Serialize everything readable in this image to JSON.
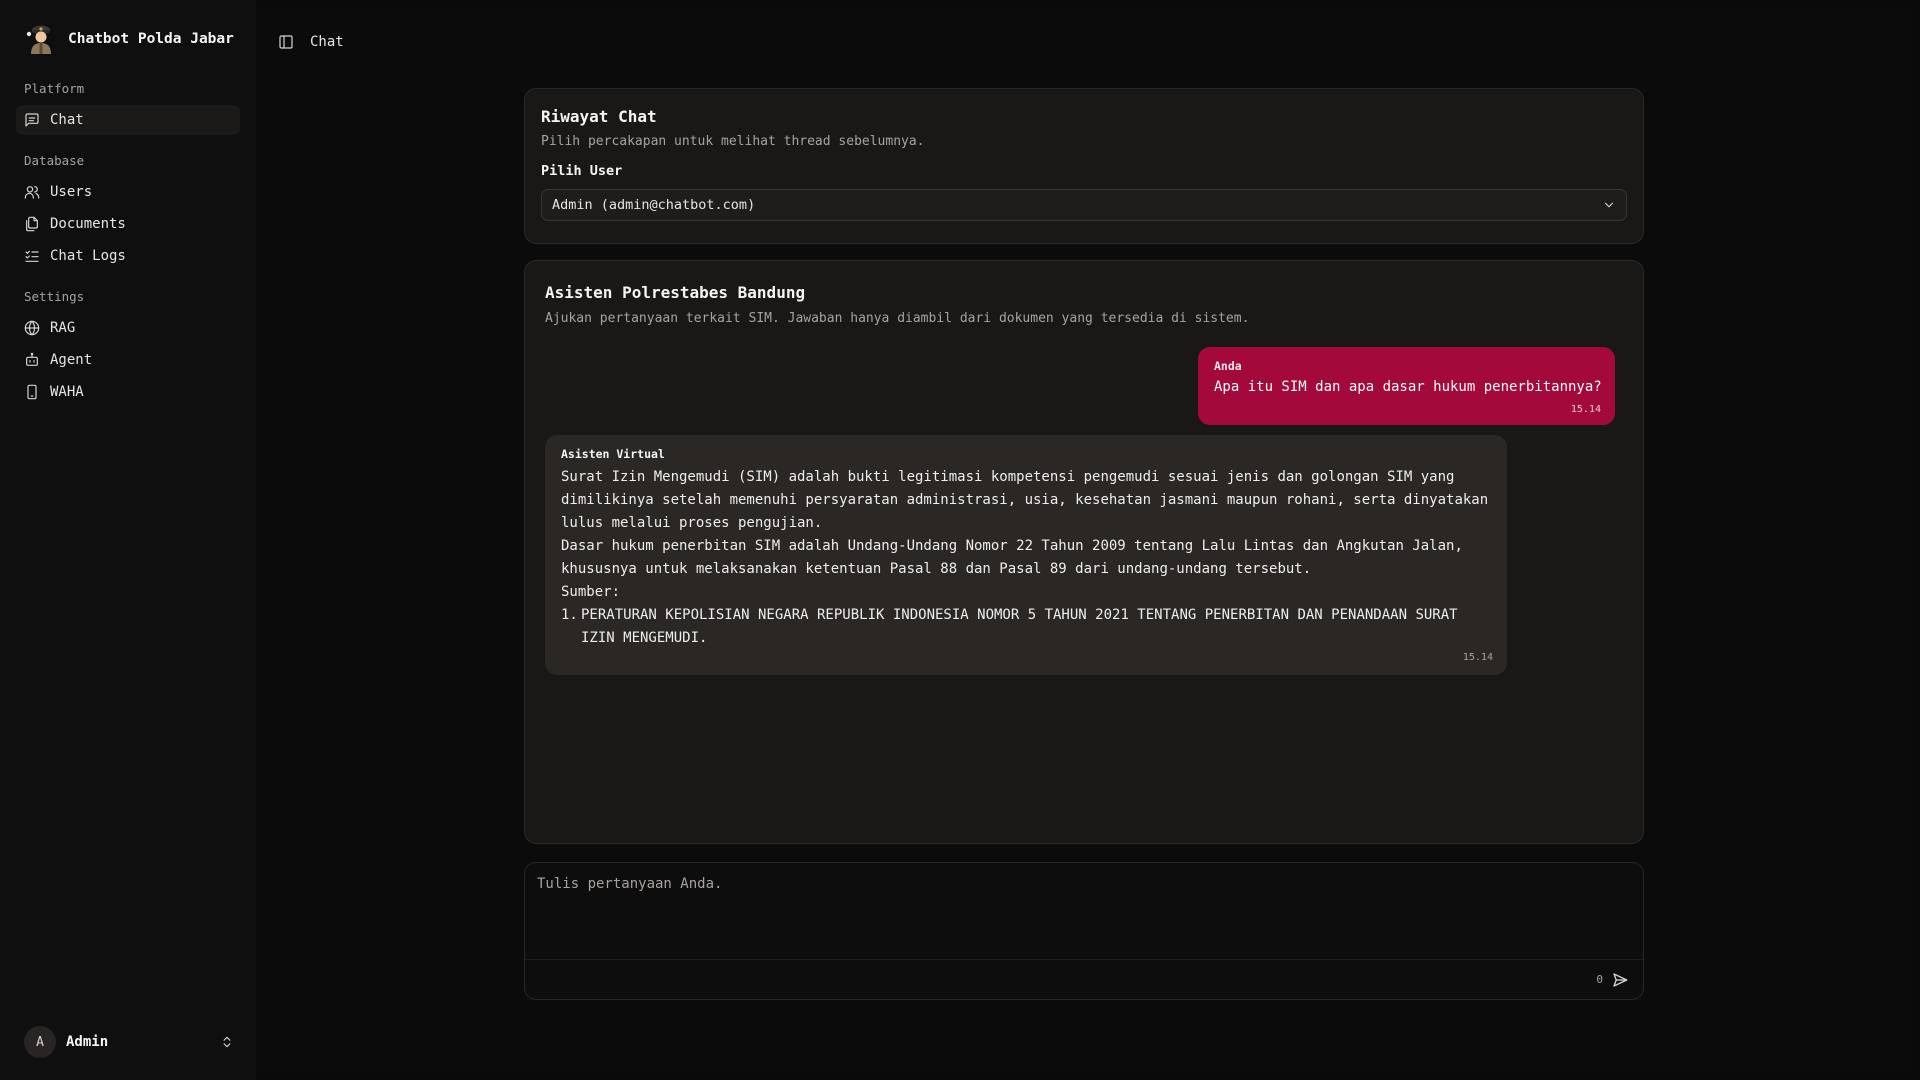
{
  "app": {
    "name": "Chatbot Polda Jabar"
  },
  "sidebar": {
    "groups": [
      {
        "label": "Platform",
        "items": [
          {
            "label": "Chat",
            "icon": "message-square-icon",
            "active": true
          }
        ]
      },
      {
        "label": "Database",
        "items": [
          {
            "label": "Users",
            "icon": "users-icon"
          },
          {
            "label": "Documents",
            "icon": "files-icon"
          },
          {
            "label": "Chat Logs",
            "icon": "list-checks-icon"
          }
        ]
      },
      {
        "label": "Settings",
        "items": [
          {
            "label": "RAG",
            "icon": "globe-icon"
          },
          {
            "label": "Agent",
            "icon": "bot-icon"
          },
          {
            "label": "WAHA",
            "icon": "smartphone-icon"
          }
        ]
      }
    ],
    "user": {
      "initial": "A",
      "name": "Admin"
    }
  },
  "topbar": {
    "title": "Chat"
  },
  "history": {
    "title": "Riwayat Chat",
    "description": "Pilih percakapan untuk melihat thread sebelumnya.",
    "user_label": "Pilih User",
    "selected_user": "Admin (admin@chatbot.com)"
  },
  "chat": {
    "title": "Asisten Polrestabes Bandung",
    "description": "Ajukan pertanyaan terkait SIM. Jawaban hanya diambil dari dokumen yang tersedia di sistem.",
    "messages": [
      {
        "sender": "Anda",
        "text": "Apa itu SIM dan apa dasar hukum penerbitannya?",
        "time": "15.14"
      },
      {
        "sender": "Asisten Virtual",
        "lines": [
          "Surat Izin Mengemudi (SIM) adalah bukti legitimasi kompetensi pengemudi sesuai jenis dan golongan SIM yang",
          "dimilikinya setelah memenuhi persyaratan administrasi, usia, kesehatan jasmani maupun rohani, serta dinyatakan",
          "lulus melalui proses pengujian.",
          "Dasar hukum penerbitan SIM adalah Undang-Undang Nomor 22 Tahun 2009 tentang Lalu Lintas dan Angkutan Jalan,",
          "khususnya untuk melaksanakan ketentuan Pasal 88 dan Pasal 89 dari undang-undang tersebut.",
          "Sumber:"
        ],
        "sources": [
          {
            "number": "1.",
            "lines": [
              "PERATURAN KEPOLISIAN NEGARA REPUBLIK INDONESIA NOMOR 5 TAHUN 2021 TENTANG PENERBITAN DAN PENANDAAN SURAT",
              "IZIN MENGEMUDI."
            ]
          }
        ],
        "time": "15.14"
      }
    ]
  },
  "composer": {
    "placeholder": "Tulis pertanyaan Anda.",
    "char_count": "0",
    "send_icon": "send-icon"
  },
  "colors": {
    "user_bubble": "#a3093b",
    "bot_bubble": "#2a2725",
    "background": "#0a0a0a"
  }
}
